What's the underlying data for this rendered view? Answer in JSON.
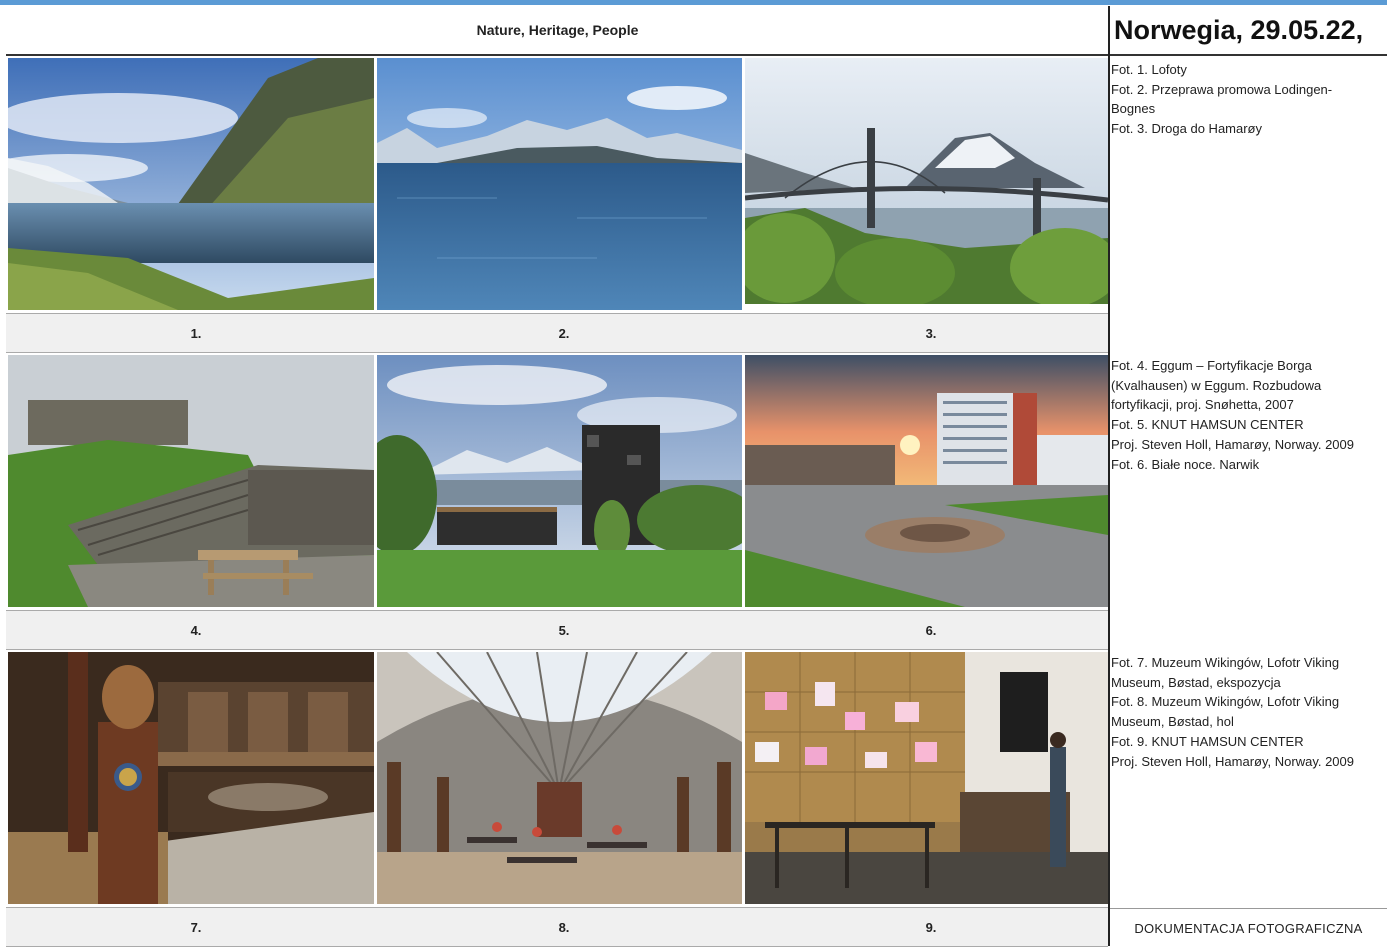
{
  "header": {
    "subtitle": "Nature, Heritage, People"
  },
  "title": "Norwegia, 29.05.22,",
  "captions": [
    "1.",
    "2.",
    "3.",
    "4.",
    "5.",
    "6.",
    "7.",
    "8.",
    "9."
  ],
  "descriptions": {
    "group1": [
      "Fot. 1. Lofoty",
      "Fot. 2. Przeprawa promowa Lodingen-\nBognes",
      "Fot. 3. Droga do  Hamarøy"
    ],
    "group2": [
      "Fot. 4. Eggum – Fortyfikacje Borga\n(Kvalhausen) w Eggum. Rozbudowa\nfortyfikacji, proj. Snøhetta, 2007",
      "Fot. 5. KNUT HAMSUN CENTER\nProj. Steven Holl, Hamarøy, Norway. 2009",
      "Fot. 6. Białe noce. Narwik"
    ],
    "group3": [
      "Fot. 7. Muzeum Wikingów,  Lofotr Viking\nMuseum,  Bøstad, ekspozycja",
      "Fot. 8. Muzeum Wikingów,  Lofotr Viking\nMuseum,  Bøstad, hol",
      "Fot. 9. KNUT HAMSUN CENTER\nProj. Steven Holl, Hamarøy, Norway. 2009"
    ]
  },
  "footer": "DOKUMENTACJA FOTOGRAFICZNA",
  "colors": {
    "accent_line": "#5b9bd5",
    "caption_bg": "#f0f0f0",
    "border": "#222222"
  }
}
